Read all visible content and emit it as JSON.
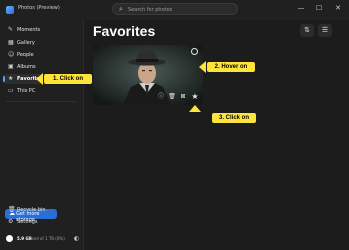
{
  "titlebar": {
    "app_title": "Photos (Preview)",
    "search_placeholder": "Search for photos",
    "controls": {
      "minimize": "—",
      "maximize": "☐",
      "close": "✕"
    }
  },
  "sidebar": {
    "items": [
      {
        "label": "Moments",
        "icon": "✎"
      },
      {
        "label": "Gallery",
        "icon": "▦"
      },
      {
        "label": "People",
        "icon": "☺"
      },
      {
        "label": "Albums",
        "icon": "▣"
      },
      {
        "label": "Favorites",
        "icon": "★"
      },
      {
        "label": "This PC",
        "icon": "▭"
      }
    ],
    "active_item": "Favorites",
    "storage_button": {
      "label": "Get more storage",
      "icon": "☁"
    },
    "recycle_bin": {
      "label": "Recycle bin",
      "icon": "🗑"
    },
    "settings": {
      "label": "Settings",
      "icon": "⚙"
    },
    "storage": {
      "used": "5.9 GB",
      "total": "used of 1 TB (0%)"
    }
  },
  "main": {
    "title": "Favorites",
    "toolbar": {
      "sort_icon": "⇅",
      "filter_icon": "☰"
    },
    "photo": {
      "actions": {
        "info": "ⓘ",
        "delete": "🗑",
        "edit": "⊠",
        "favorite": "★"
      }
    }
  },
  "callouts": {
    "step1": "1. Click on",
    "step2": "2. Hover on",
    "step3": "3. Click on"
  },
  "colors": {
    "accent": "#2b6fd6",
    "callout": "#fde43a",
    "background": "#1c1c1c",
    "sidebar": "#202020"
  }
}
